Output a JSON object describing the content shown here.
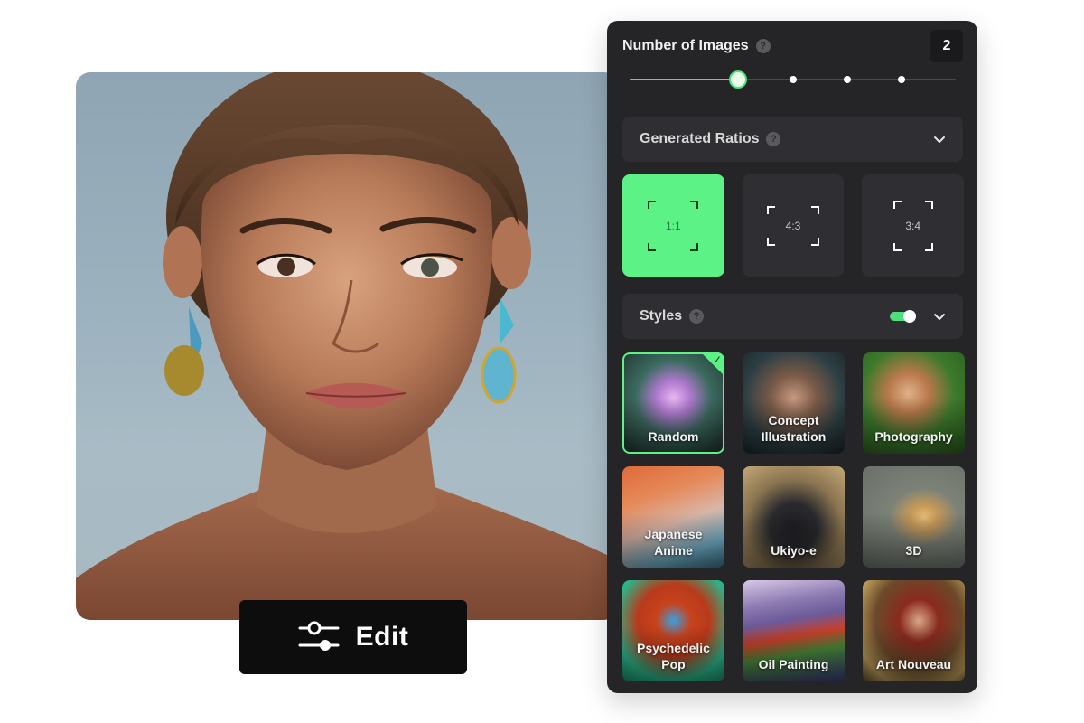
{
  "edit_button": {
    "label": "Edit",
    "icon": "sliders-icon"
  },
  "panel": {
    "number_of_images": {
      "title": "Number of Images",
      "help_icon": "?",
      "value": "2",
      "slider": {
        "min": 1,
        "max": 6,
        "value": 2,
        "steps": [
          2,
          3,
          4,
          5
        ]
      }
    },
    "generated_ratios": {
      "title": "Generated Ratios",
      "help_icon": "?",
      "expanded": true,
      "options": [
        {
          "label": "1:1",
          "selected": true
        },
        {
          "label": "4:3",
          "selected": false
        },
        {
          "label": "3:4",
          "selected": false
        }
      ]
    },
    "styles": {
      "title": "Styles",
      "help_icon": "?",
      "toggle_on": true,
      "items": [
        {
          "label": "Random",
          "selected": true
        },
        {
          "label": "Concept Illustration",
          "selected": false
        },
        {
          "label": "Photography",
          "selected": false
        },
        {
          "label": "Japanese Anime",
          "selected": false
        },
        {
          "label": "Ukiyo-e",
          "selected": false
        },
        {
          "label": "3D",
          "selected": false
        },
        {
          "label": "Psychedelic Pop",
          "selected": false
        },
        {
          "label": "Oil Painting",
          "selected": false
        },
        {
          "label": "Art Nouveau",
          "selected": false
        }
      ]
    }
  },
  "colors": {
    "accent": "#5df285",
    "panel_bg": "#252528",
    "section_bg": "#2f2f33",
    "edit_button_bg": "#0d0d0d"
  }
}
